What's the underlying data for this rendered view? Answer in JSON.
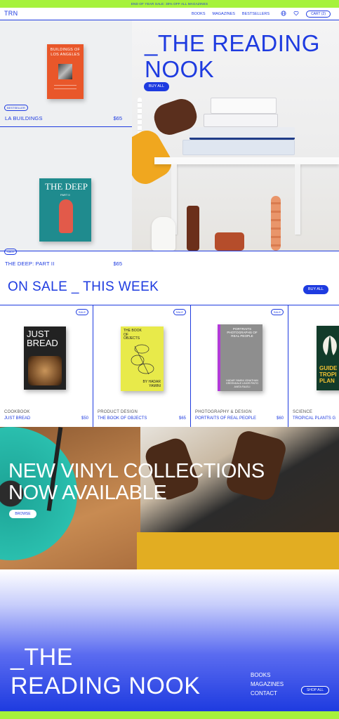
{
  "promo": {
    "text": "END OF YEAR SALE: 30% OFF ALL MAGAZINES"
  },
  "nav": {
    "logo": "TRN",
    "links": [
      "BOOKS",
      "MAGAZINES",
      "BESTSELLERS"
    ],
    "cart": "CART (2)"
  },
  "hero": {
    "title_line1": "_THE READING",
    "title_line2": "NOOK",
    "cta": "BUY ALL"
  },
  "featured": [
    {
      "badge": "BESTSELLER",
      "title": "LA BUILDINGS",
      "price": "$65",
      "cover_title": "BUILDINGS OF LOS ANGELES"
    },
    {
      "badge": "SALE",
      "title": "THE DEEP: PART II",
      "price": "$65",
      "cover_title": "THE DEEP",
      "cover_sub": "PART II"
    }
  ],
  "sale": {
    "title": "ON SALE _ THIS WEEK",
    "cta": "BUY ALL",
    "items": [
      {
        "badge": "SALE",
        "category": "COOKBOOK",
        "name": "JUST BREAD",
        "price": "$50",
        "cover_text": "JUST BREAD"
      },
      {
        "badge": "SALE",
        "category": "PRODUCT DESIGN",
        "name": "THE BOOK OF OBJECTS",
        "price": "$65",
        "cover_text": "THE BOOK OF OBJECTS",
        "cover_author": "BY HADAR YAMINI"
      },
      {
        "badge": "SALE",
        "category": "PHOTOGRAPHY & DESIGN",
        "name": "PORTRAITS OF REAL PEOPLE",
        "price": "$60",
        "cover_text": "PORTRAITS PHOTOGRAPHS OF REAL PEOPLE",
        "cover_author": "HADAR YAMINI JONATHAN GREENDALE LINOR PINTO ANITA FALELI"
      },
      {
        "category": "SCIENCE",
        "name": "TROPICAL PLANTS G",
        "cover_text": "GUIDE TROPI PLAN"
      }
    ]
  },
  "vinyl": {
    "title_line1": "NEW VINYL COLLECTIONS",
    "title_line2": "NOW AVAILABLE",
    "cta": "BROWSE"
  },
  "footer": {
    "title_line1": "_THE",
    "title_line2": "READING NOOK",
    "links": [
      "BOOKS",
      "MAGAZINES",
      "CONTACT"
    ],
    "cta": "SHOP ALL"
  },
  "colors": {
    "accent": "#1e3be0",
    "promo": "#a6f23c"
  }
}
